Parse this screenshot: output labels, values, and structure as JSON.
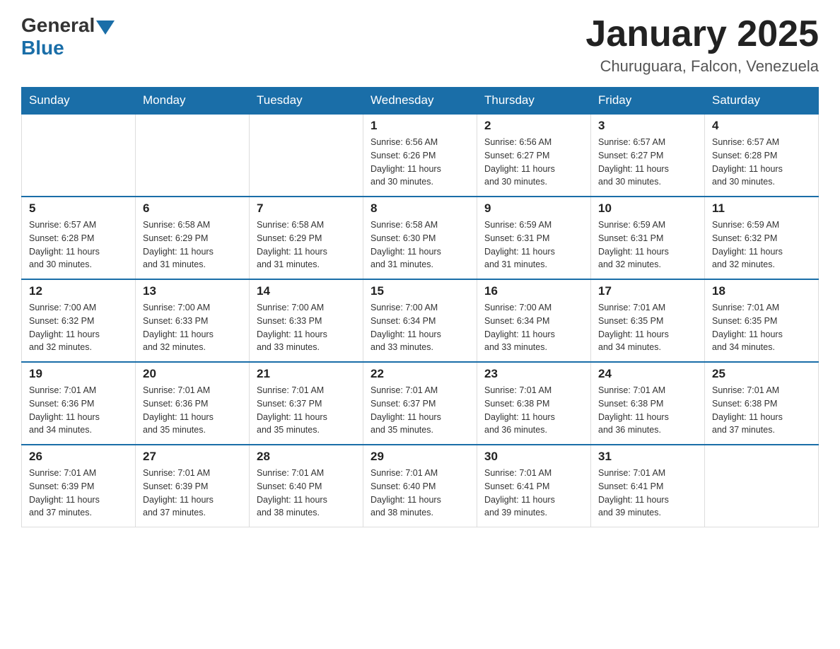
{
  "header": {
    "logo_general": "General",
    "logo_blue": "Blue",
    "month_title": "January 2025",
    "location": "Churuguara, Falcon, Venezuela"
  },
  "weekdays": [
    "Sunday",
    "Monday",
    "Tuesday",
    "Wednesday",
    "Thursday",
    "Friday",
    "Saturday"
  ],
  "weeks": [
    [
      {
        "day": "",
        "info": ""
      },
      {
        "day": "",
        "info": ""
      },
      {
        "day": "",
        "info": ""
      },
      {
        "day": "1",
        "info": "Sunrise: 6:56 AM\nSunset: 6:26 PM\nDaylight: 11 hours\nand 30 minutes."
      },
      {
        "day": "2",
        "info": "Sunrise: 6:56 AM\nSunset: 6:27 PM\nDaylight: 11 hours\nand 30 minutes."
      },
      {
        "day": "3",
        "info": "Sunrise: 6:57 AM\nSunset: 6:27 PM\nDaylight: 11 hours\nand 30 minutes."
      },
      {
        "day": "4",
        "info": "Sunrise: 6:57 AM\nSunset: 6:28 PM\nDaylight: 11 hours\nand 30 minutes."
      }
    ],
    [
      {
        "day": "5",
        "info": "Sunrise: 6:57 AM\nSunset: 6:28 PM\nDaylight: 11 hours\nand 30 minutes."
      },
      {
        "day": "6",
        "info": "Sunrise: 6:58 AM\nSunset: 6:29 PM\nDaylight: 11 hours\nand 31 minutes."
      },
      {
        "day": "7",
        "info": "Sunrise: 6:58 AM\nSunset: 6:29 PM\nDaylight: 11 hours\nand 31 minutes."
      },
      {
        "day": "8",
        "info": "Sunrise: 6:58 AM\nSunset: 6:30 PM\nDaylight: 11 hours\nand 31 minutes."
      },
      {
        "day": "9",
        "info": "Sunrise: 6:59 AM\nSunset: 6:31 PM\nDaylight: 11 hours\nand 31 minutes."
      },
      {
        "day": "10",
        "info": "Sunrise: 6:59 AM\nSunset: 6:31 PM\nDaylight: 11 hours\nand 32 minutes."
      },
      {
        "day": "11",
        "info": "Sunrise: 6:59 AM\nSunset: 6:32 PM\nDaylight: 11 hours\nand 32 minutes."
      }
    ],
    [
      {
        "day": "12",
        "info": "Sunrise: 7:00 AM\nSunset: 6:32 PM\nDaylight: 11 hours\nand 32 minutes."
      },
      {
        "day": "13",
        "info": "Sunrise: 7:00 AM\nSunset: 6:33 PM\nDaylight: 11 hours\nand 32 minutes."
      },
      {
        "day": "14",
        "info": "Sunrise: 7:00 AM\nSunset: 6:33 PM\nDaylight: 11 hours\nand 33 minutes."
      },
      {
        "day": "15",
        "info": "Sunrise: 7:00 AM\nSunset: 6:34 PM\nDaylight: 11 hours\nand 33 minutes."
      },
      {
        "day": "16",
        "info": "Sunrise: 7:00 AM\nSunset: 6:34 PM\nDaylight: 11 hours\nand 33 minutes."
      },
      {
        "day": "17",
        "info": "Sunrise: 7:01 AM\nSunset: 6:35 PM\nDaylight: 11 hours\nand 34 minutes."
      },
      {
        "day": "18",
        "info": "Sunrise: 7:01 AM\nSunset: 6:35 PM\nDaylight: 11 hours\nand 34 minutes."
      }
    ],
    [
      {
        "day": "19",
        "info": "Sunrise: 7:01 AM\nSunset: 6:36 PM\nDaylight: 11 hours\nand 34 minutes."
      },
      {
        "day": "20",
        "info": "Sunrise: 7:01 AM\nSunset: 6:36 PM\nDaylight: 11 hours\nand 35 minutes."
      },
      {
        "day": "21",
        "info": "Sunrise: 7:01 AM\nSunset: 6:37 PM\nDaylight: 11 hours\nand 35 minutes."
      },
      {
        "day": "22",
        "info": "Sunrise: 7:01 AM\nSunset: 6:37 PM\nDaylight: 11 hours\nand 35 minutes."
      },
      {
        "day": "23",
        "info": "Sunrise: 7:01 AM\nSunset: 6:38 PM\nDaylight: 11 hours\nand 36 minutes."
      },
      {
        "day": "24",
        "info": "Sunrise: 7:01 AM\nSunset: 6:38 PM\nDaylight: 11 hours\nand 36 minutes."
      },
      {
        "day": "25",
        "info": "Sunrise: 7:01 AM\nSunset: 6:38 PM\nDaylight: 11 hours\nand 37 minutes."
      }
    ],
    [
      {
        "day": "26",
        "info": "Sunrise: 7:01 AM\nSunset: 6:39 PM\nDaylight: 11 hours\nand 37 minutes."
      },
      {
        "day": "27",
        "info": "Sunrise: 7:01 AM\nSunset: 6:39 PM\nDaylight: 11 hours\nand 37 minutes."
      },
      {
        "day": "28",
        "info": "Sunrise: 7:01 AM\nSunset: 6:40 PM\nDaylight: 11 hours\nand 38 minutes."
      },
      {
        "day": "29",
        "info": "Sunrise: 7:01 AM\nSunset: 6:40 PM\nDaylight: 11 hours\nand 38 minutes."
      },
      {
        "day": "30",
        "info": "Sunrise: 7:01 AM\nSunset: 6:41 PM\nDaylight: 11 hours\nand 39 minutes."
      },
      {
        "day": "31",
        "info": "Sunrise: 7:01 AM\nSunset: 6:41 PM\nDaylight: 11 hours\nand 39 minutes."
      },
      {
        "day": "",
        "info": ""
      }
    ]
  ]
}
